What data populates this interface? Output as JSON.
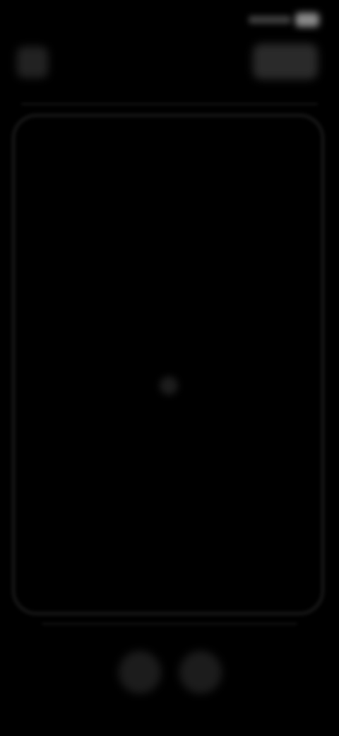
{
  "status_bar": {
    "time": "",
    "battery_icon": "battery-icon",
    "signal_icon": "signal-icon"
  },
  "header": {
    "title": "",
    "back_icon": "back-icon",
    "action_icon": "action-icon"
  },
  "content": {
    "empty_message": "",
    "indicator_icon": "dot-icon"
  },
  "bottom_controls": {
    "left_icon": "circle-button-icon",
    "right_icon": "circle-button-icon"
  }
}
